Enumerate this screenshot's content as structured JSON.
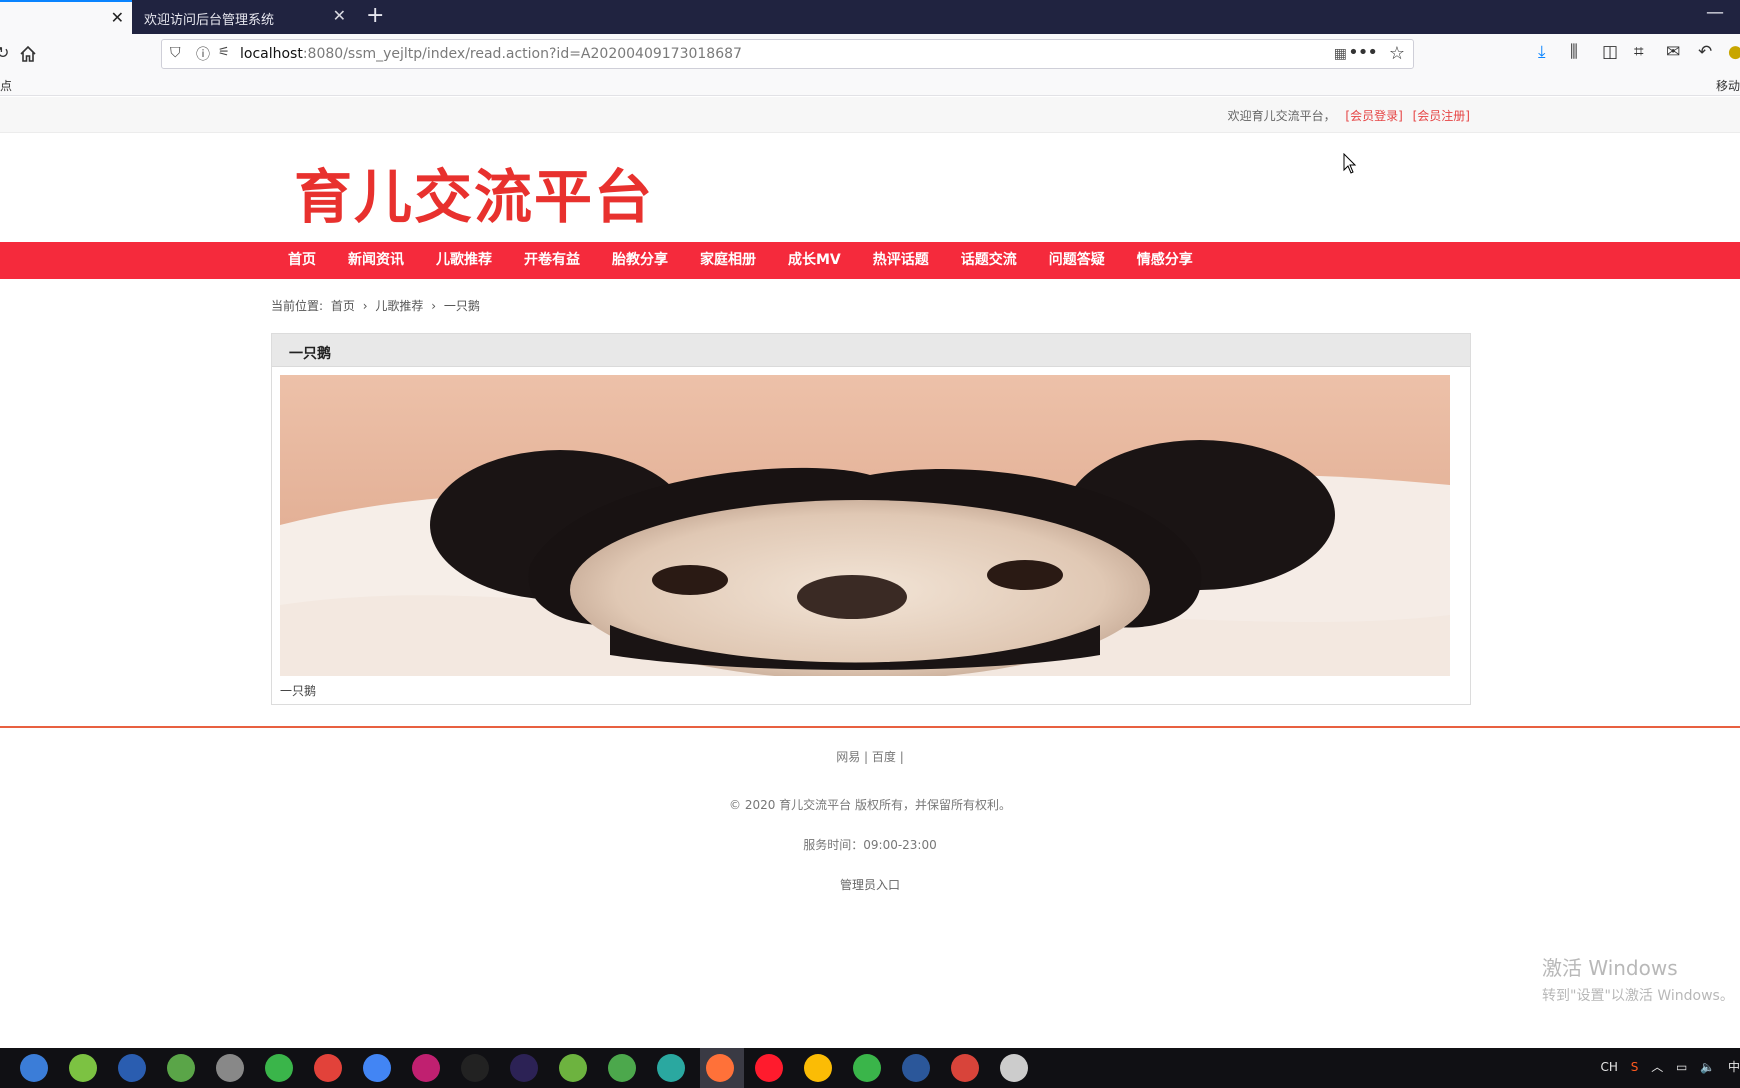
{
  "browser": {
    "tab_title": "欢迎访问后台管理系统",
    "close_glyph": "✕",
    "new_tab_glyph": "+",
    "minimize_glyph": "—",
    "url_host": "localhost",
    "url_rest": ":8080/ssm_yejltp/index/read.action?id=A20200409173018687",
    "bookmark_left": "点",
    "bookmark_right": "移动"
  },
  "site": {
    "welcome": "欢迎育儿交流平台，",
    "login": "[会员登录]",
    "register": "[会员注册]",
    "logo": "育儿交流平台"
  },
  "menu": [
    "首页",
    "新闻资讯",
    "儿歌推荐",
    "开卷有益",
    "胎教分享",
    "家庭相册",
    "成长MV",
    "热评话题",
    "话题交流",
    "问题答疑",
    "情感分享"
  ],
  "breadcrumb": {
    "prefix": "当前位置:",
    "home": "首页",
    "section": "儿歌推荐",
    "current": "一只鹅",
    "sep": "›"
  },
  "article": {
    "title": "一只鹅",
    "caption": "一只鹅"
  },
  "footer": {
    "links": "网易 | 百度 |",
    "copyright": "© 2020 育儿交流平台 版权所有，并保留所有权利。",
    "hours": "服务时间：09:00-23:00",
    "admin": "管理员入口"
  },
  "watermark": {
    "line1": "激活 Windows",
    "line2": "转到\"设置\"以激活 Windows。"
  },
  "tray": {
    "ime": "CH",
    "lang": "中"
  },
  "colors": {
    "menu_bg": "#f52a3c",
    "logo": "#e8312e",
    "link_red": "#e64545",
    "footer_line": "#e86040"
  }
}
